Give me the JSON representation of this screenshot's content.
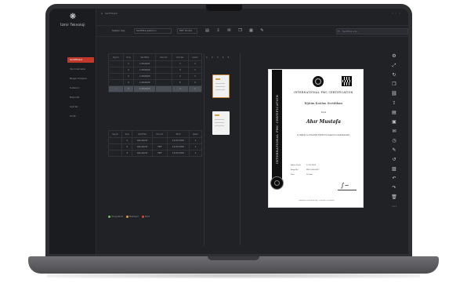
{
  "app": {
    "brand": "İzmir Teknoloji",
    "breadcrumb": "Sertifikalar"
  },
  "sidebar": {
    "items": [
      {
        "label": "Sertifikalar",
        "active": true
      },
      {
        "label": "Tanımlamalar",
        "active": false
      },
      {
        "label": "Belge Onayları",
        "active": false
      },
      {
        "label": "Kullanıcı",
        "active": false
      },
      {
        "label": "Raporlar",
        "active": false
      },
      {
        "label": "Ayarlar",
        "active": false
      },
      {
        "label": "Profil",
        "active": false
      }
    ]
  },
  "toolbar": {
    "template_label": "Şablon Seç",
    "template_value": "Sertifika Şablonu",
    "font_value": "PDF Önizle",
    "search_placeholder": "Sertifika ara..."
  },
  "top_table": {
    "headers": [
      "Seçim",
      "Sıra",
      "Sertifika",
      "Durum",
      "Gönder",
      "İşlem"
    ],
    "rows": [
      [
        "",
        "1",
        "C-2024/01",
        "",
        "7",
        "2"
      ],
      [
        "",
        "2",
        "C-2024/02",
        "",
        "3",
        "1"
      ],
      [
        "",
        "3",
        "C-2024/03",
        "",
        "2",
        "1"
      ],
      [
        "",
        "4",
        "C-2024/04",
        "",
        "5",
        "2"
      ],
      [
        "✓",
        "5",
        "C-2024/05",
        "",
        "4",
        "1"
      ]
    ]
  },
  "bottom_table": {
    "headers": [
      "Seçim",
      "Sıra",
      "Sertifika",
      "Durum",
      "Tarih",
      "İşlem"
    ],
    "rows": [
      [
        "",
        "1",
        "Gönderildi",
        "",
        "12.03.2024",
        "1"
      ],
      [
        "",
        "2",
        "Gönderildi",
        "PDF",
        "14.03.2024",
        "1"
      ],
      [
        "",
        "3",
        "Gönderildi",
        "PDF",
        "15.03.2024",
        "1"
      ]
    ]
  },
  "page_numbers": "1 2 3 4 5",
  "legend": {
    "items": [
      {
        "label": "Onaylandı",
        "color": "#6ec05a"
      },
      {
        "label": "Bekliyor",
        "color": "#e0a23a"
      },
      {
        "label": "Red",
        "color": "#d9453a"
      }
    ]
  },
  "certificate": {
    "ribbon": "INTERNATIONAL PMC CERTIFICATION",
    "org": "INTERNATIONAL PMC CERTIFICATION",
    "title": "Eğitim Katılım Sertifikası",
    "given_to_label": "Sayın",
    "recipient_name": "Ahır Mustafa",
    "body_text": "İş Sağlığı ve Güvenliği Eğitimi'ni başarıyla tamamlamıştır.",
    "date_rows": [
      {
        "label": "Eğitim Tarihi",
        "value": "12.03.2024"
      },
      {
        "label": "Belge No",
        "value": "PMC-2024-0317"
      },
      {
        "label": "Süre",
        "value": "16 Saat"
      }
    ],
    "footer": "www.pmc-certification.org · certificate verification"
  }
}
